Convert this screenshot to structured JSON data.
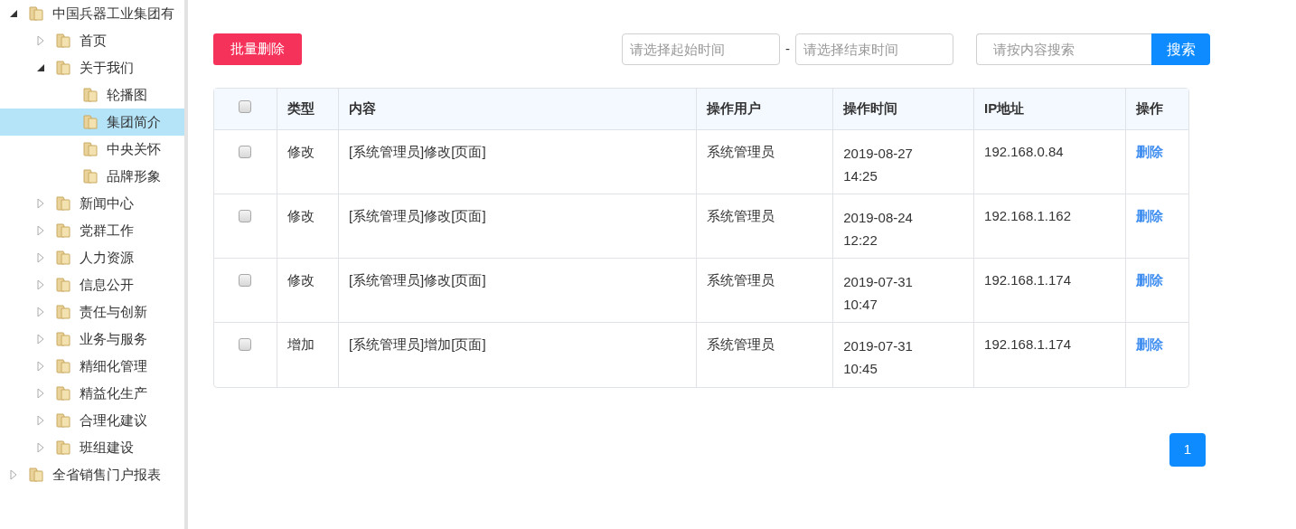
{
  "tree": [
    {
      "label": "中国兵器工业集团有",
      "expanded": true,
      "selected": false,
      "children": [
        {
          "label": "首页",
          "expanded": false,
          "selected": false
        },
        {
          "label": "关于我们",
          "expanded": true,
          "selected": false,
          "children": [
            {
              "label": "轮播图",
              "selected": false
            },
            {
              "label": "集团简介",
              "selected": true
            },
            {
              "label": "中央关怀",
              "selected": false
            },
            {
              "label": "品牌形象",
              "selected": false
            }
          ]
        },
        {
          "label": "新闻中心",
          "expanded": false,
          "selected": false
        },
        {
          "label": "党群工作",
          "expanded": false,
          "selected": false
        },
        {
          "label": "人力资源",
          "expanded": false,
          "selected": false
        },
        {
          "label": "信息公开",
          "expanded": false,
          "selected": false
        },
        {
          "label": "责任与创新",
          "expanded": false,
          "selected": false
        },
        {
          "label": "业务与服务",
          "expanded": false,
          "selected": false
        },
        {
          "label": "精细化管理",
          "expanded": false,
          "selected": false
        },
        {
          "label": "精益化生产",
          "expanded": false,
          "selected": false
        },
        {
          "label": "合理化建议",
          "expanded": false,
          "selected": false
        },
        {
          "label": "班组建设",
          "expanded": false,
          "selected": false
        }
      ]
    },
    {
      "label": "全省销售门户报表",
      "expanded": false,
      "selected": false
    }
  ],
  "toolbar": {
    "batch_delete": "批量删除",
    "start_date": {
      "placeholder": "请选择起始时间"
    },
    "separator": "-",
    "end_date": {
      "placeholder": "请选择结束时间"
    },
    "search": {
      "placeholder": "请按内容搜索"
    },
    "search_button": "搜索"
  },
  "table": {
    "select_all_checked": false,
    "columns": [
      "类型",
      "内容",
      "操作用户",
      "操作时间",
      "IP地址",
      "操作"
    ],
    "rows": [
      {
        "checked": false,
        "type": "修改",
        "content": "[系统管理员]修改[页面]",
        "user": "系统管理员",
        "date": "2019-08-27",
        "time": "14:25",
        "ip": "192.168.0.84",
        "action": "删除"
      },
      {
        "checked": false,
        "type": "修改",
        "content": "[系统管理员]修改[页面]",
        "user": "系统管理员",
        "date": "2019-08-24",
        "time": "12:22",
        "ip": "192.168.1.162",
        "action": "删除"
      },
      {
        "checked": false,
        "type": "修改",
        "content": "[系统管理员]修改[页面]",
        "user": "系统管理员",
        "date": "2019-07-31",
        "time": "10:47",
        "ip": "192.168.1.174",
        "action": "删除"
      },
      {
        "checked": false,
        "type": "增加",
        "content": "[系统管理员]增加[页面]",
        "user": "系统管理员",
        "date": "2019-07-31",
        "time": "10:45",
        "ip": "192.168.1.174",
        "action": "删除"
      }
    ]
  },
  "pagination": [
    {
      "label": "1",
      "selected": true
    }
  ]
}
